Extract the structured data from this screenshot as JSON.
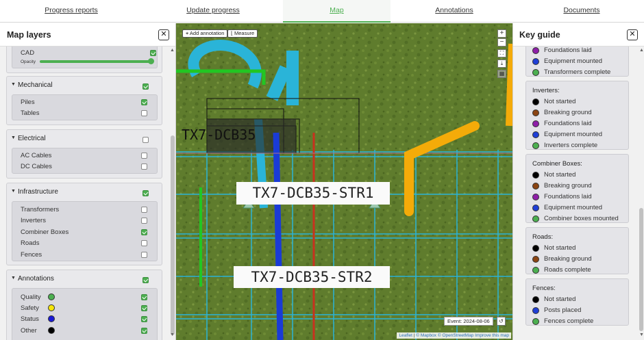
{
  "tabs": [
    {
      "label": "Progress reports",
      "active": false
    },
    {
      "label": "Update progress",
      "active": false
    },
    {
      "label": "Map",
      "active": true
    },
    {
      "label": "Annotations",
      "active": false
    },
    {
      "label": "Documents",
      "active": false
    }
  ],
  "colors": {
    "accent": "#4caf50",
    "checkbox_on": "#4caf50"
  },
  "left_panel": {
    "title": "Map layers",
    "close": "✕",
    "cad": {
      "label": "CAD",
      "checked": true,
      "opacity_label": "Opacity",
      "opacity_value": 1.0
    },
    "sections": [
      {
        "title": "Mechanical",
        "checked": true,
        "items": [
          {
            "label": "Piles",
            "checked": true
          },
          {
            "label": "Tables",
            "checked": false
          }
        ]
      },
      {
        "title": "Electrical",
        "checked": false,
        "items": [
          {
            "label": "AC Cables",
            "checked": false
          },
          {
            "label": "DC Cables",
            "checked": false
          }
        ]
      },
      {
        "title": "Infrastructure",
        "checked": true,
        "items": [
          {
            "label": "Transformers",
            "checked": false
          },
          {
            "label": "Inverters",
            "checked": false
          },
          {
            "label": "Combiner Boxes",
            "checked": true
          },
          {
            "label": "Roads",
            "checked": false
          },
          {
            "label": "Fences",
            "checked": false
          }
        ]
      },
      {
        "title": "Annotations",
        "checked": true,
        "items": [
          {
            "label": "Quality",
            "checked": true,
            "color": "#4caf50"
          },
          {
            "label": "Safety",
            "checked": true,
            "color": "#f5e50a"
          },
          {
            "label": "Status",
            "checked": true,
            "color": "#1a1ad6"
          },
          {
            "label": "Other",
            "checked": true,
            "color": "#000000"
          }
        ]
      }
    ]
  },
  "map": {
    "add_annotation": "Add annotation",
    "measure": "Measure",
    "zoom_in": "+",
    "zoom_out": "−",
    "labels": [
      "TX7-DCB35",
      "TX7-DCB35-STR1",
      "TX7-DCB35-STR2"
    ],
    "event": "Event: 2024-08-06",
    "attribution": {
      "leaflet": "Leaflet",
      "sep": "|",
      "mapbox": "© Mapbox",
      "osm": "© OpenStreetMap",
      "improve": "Improve this map"
    }
  },
  "right_panel": {
    "title": "Key guide",
    "close": "✕",
    "groups": [
      {
        "title": "",
        "items": [
          {
            "label": "Foundations laid",
            "color": "#8e1fa8"
          },
          {
            "label": "Equipment mounted",
            "color": "#1f3fd6"
          },
          {
            "label": "Transformers complete",
            "color": "#4caf50"
          }
        ]
      },
      {
        "title": "Inverters:",
        "items": [
          {
            "label": "Not started",
            "color": "#000000"
          },
          {
            "label": "Breaking ground",
            "color": "#8b4513"
          },
          {
            "label": "Foundations laid",
            "color": "#8e1fa8"
          },
          {
            "label": "Equipment mounted",
            "color": "#1f3fd6"
          },
          {
            "label": "Inverters complete",
            "color": "#4caf50"
          }
        ]
      },
      {
        "title": "Combiner Boxes:",
        "items": [
          {
            "label": "Not started",
            "color": "#000000"
          },
          {
            "label": "Breaking ground",
            "color": "#8b4513"
          },
          {
            "label": "Foundations laid",
            "color": "#8e1fa8"
          },
          {
            "label": "Equipment mounted",
            "color": "#1f3fd6"
          },
          {
            "label": "Combiner boxes mounted",
            "color": "#4caf50"
          }
        ]
      },
      {
        "title": "Roads:",
        "items": [
          {
            "label": "Not started",
            "color": "#000000"
          },
          {
            "label": "Breaking ground",
            "color": "#8b4513"
          },
          {
            "label": "Roads complete",
            "color": "#4caf50"
          }
        ]
      },
      {
        "title": "Fences:",
        "items": [
          {
            "label": "Not started",
            "color": "#000000"
          },
          {
            "label": "Posts placed",
            "color": "#1f3fd6"
          },
          {
            "label": "Fences complete",
            "color": "#4caf50"
          }
        ]
      }
    ]
  }
}
